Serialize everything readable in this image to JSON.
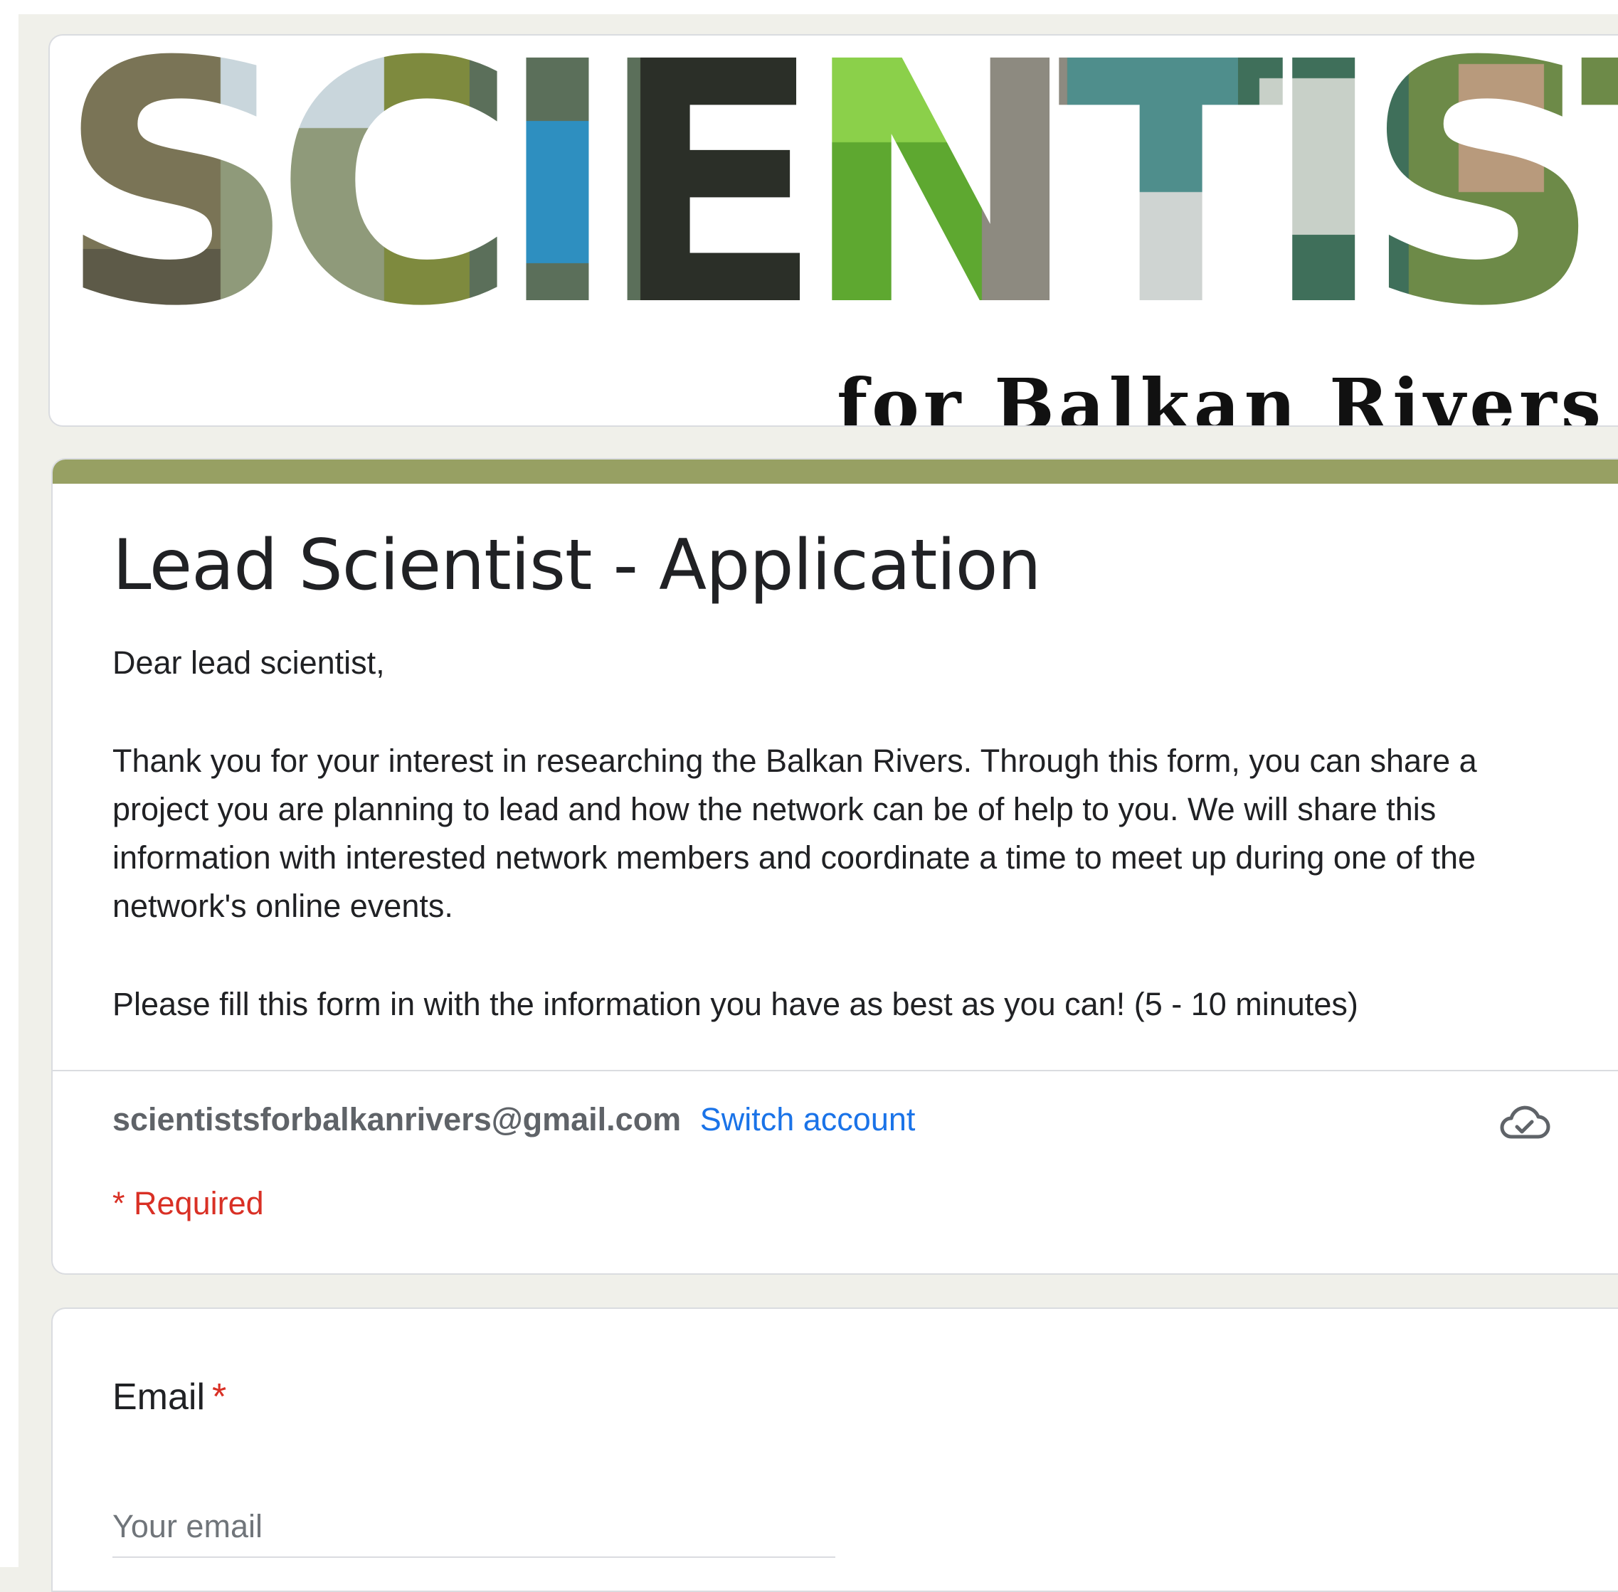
{
  "banner": {
    "main_text": "SCIENTISTS",
    "subtitle": "for Balkan Rivers"
  },
  "form": {
    "title": "Lead Scientist - Application",
    "greeting": "Dear lead scientist,",
    "paragraph": "Thank you for your interest in researching the Balkan Rivers. Through this form, you can share a project you are planning to lead and how the network can be of help to you. We will share this information with interested network members and coordinate a time to meet up during one of the network's online events.",
    "instruction": "Please fill this form in with the information you have as best as you can! (5 - 10 minutes)",
    "account_email": "scientistsforbalkanrivers@gmail.com",
    "switch_account": "Switch account",
    "required_note": "* Required",
    "accent_color": "#97a063"
  },
  "questions": [
    {
      "label": "Email",
      "required_marker": "*",
      "placeholder": "Your email"
    }
  ],
  "icons": {
    "save_status": "cloud-check-icon"
  }
}
